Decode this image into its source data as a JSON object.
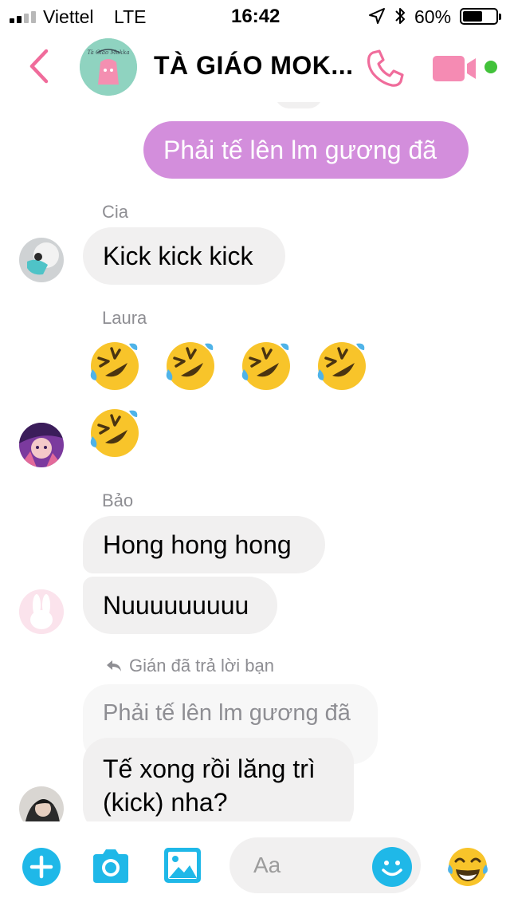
{
  "status_bar": {
    "carrier": "Viettel",
    "network": "LTE",
    "time": "16:42",
    "battery_percent": "60%",
    "battery_level": 0.6,
    "signal_bars_active": 2,
    "signal_bars_total": 4
  },
  "header": {
    "title": "TÀ GIÁO MOK...",
    "avatar_text": "Tà Giáo Mokka",
    "accent_color": "#f06c9b",
    "online_color": "#42c23a"
  },
  "messages": {
    "outgoing_1": "Phải tế lên lm gương đã",
    "cia": {
      "sender": "Cia",
      "text": "Kick kick kick"
    },
    "laura": {
      "sender": "Laura",
      "emoji": [
        "rolling-on-floor-laughing",
        "rolling-on-floor-laughing",
        "rolling-on-floor-laughing",
        "rolling-on-floor-laughing",
        "rolling-on-floor-laughing"
      ]
    },
    "bao": {
      "sender": "Bảo",
      "text_1": "Hong hong hong",
      "text_2": "Nuuuuuuuuu"
    },
    "reply": {
      "note": "Gián đã trả lời bạn",
      "quoted": "Phải tế lên lm gương đã",
      "line_1": "Tế xong rồi lăng trì",
      "line_2": "(kick) nha?"
    }
  },
  "composer": {
    "placeholder": "Aa"
  },
  "colors": {
    "outgoing_bubble": "#d38edc",
    "incoming_bubble": "#f1f0f0",
    "composer_icon": "#1fb8e8",
    "video_icon": "#f58bb3"
  }
}
